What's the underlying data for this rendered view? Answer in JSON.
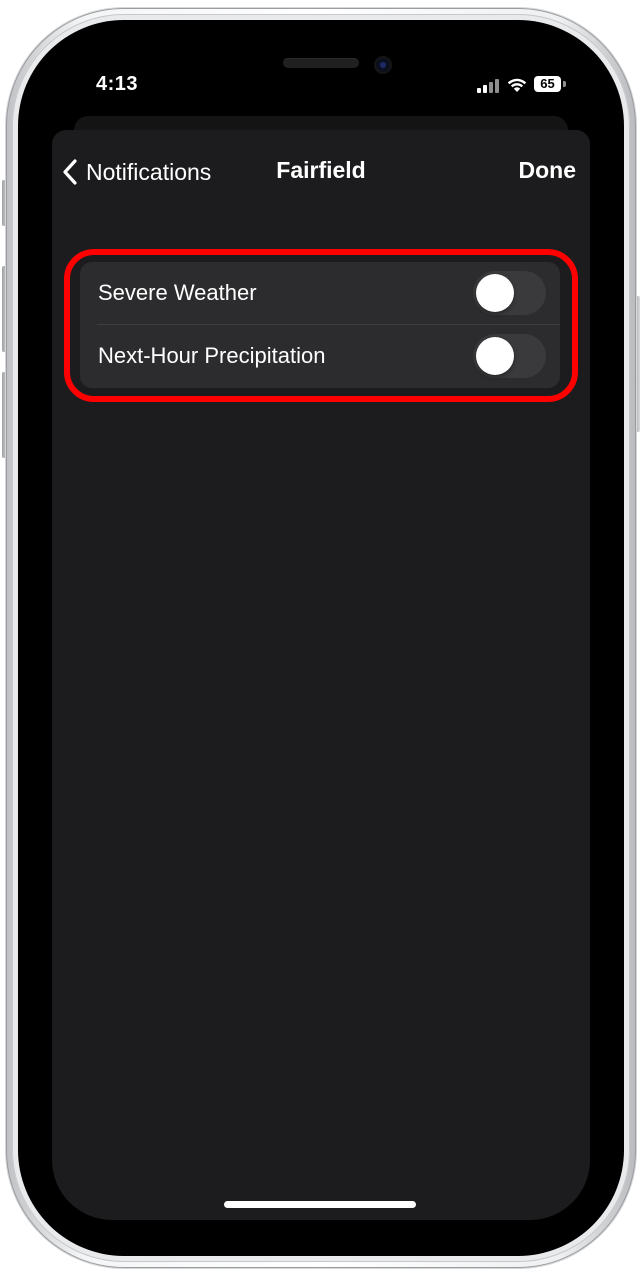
{
  "status_bar": {
    "time": "4:13",
    "battery": "65",
    "icons": [
      "cellular-signal-icon",
      "wifi-icon",
      "battery-icon"
    ]
  },
  "nav": {
    "back_label": "Notifications",
    "title": "Fairfield",
    "done_label": "Done"
  },
  "settings": {
    "rows": [
      {
        "label": "Severe Weather",
        "enabled": false
      },
      {
        "label": "Next-Hour Precipitation",
        "enabled": false
      }
    ]
  },
  "colors": {
    "sheet_background": "#1c1c1e",
    "group_background": "#2c2c2e",
    "toggle_off": "#3a3a3c",
    "highlight": "#ff0000",
    "text": "#ffffff"
  }
}
